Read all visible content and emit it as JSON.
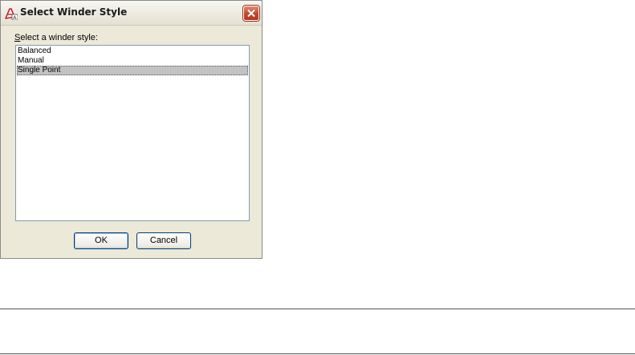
{
  "dialog": {
    "title": "Select Winder Style",
    "icon": "autocad-app-icon",
    "close_icon": "close-icon",
    "prompt_accel": "S",
    "prompt_rest": "elect a winder style:",
    "list_items": [
      {
        "label": "Balanced",
        "selected": false
      },
      {
        "label": "Manual",
        "selected": false
      },
      {
        "label": "Single Point",
        "selected": true
      }
    ],
    "ok_label": "OK",
    "cancel_label": "Cancel"
  },
  "colors": {
    "dialog_bg": "#ece9d8",
    "close_button": "#c0452a",
    "selection": "#c2c2c2",
    "listbox_border": "#7f9db9",
    "button_border": "#003c74"
  }
}
